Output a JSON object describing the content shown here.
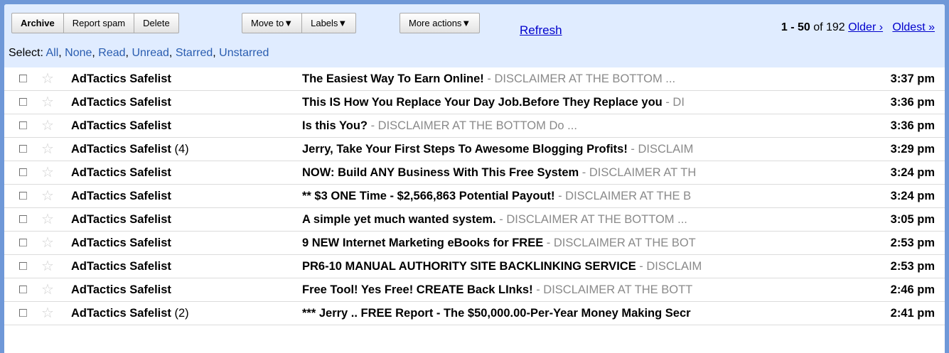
{
  "toolbar": {
    "group1": [
      "Archive",
      "Report spam",
      "Delete"
    ],
    "move_to": "Move to▼",
    "labels": "Labels▼",
    "more_actions": "More actions▼",
    "refresh": "Refresh"
  },
  "pager": {
    "range": "1 - 50",
    "of_text": "of 192",
    "older": "Older ›",
    "oldest": "Oldest »"
  },
  "select": {
    "label": "Select:",
    "options": [
      "All",
      "None",
      "Read",
      "Unread",
      "Starred",
      "Unstarred"
    ]
  },
  "emails": [
    {
      "sender": "AdTactics Safelist",
      "count": "",
      "subject": "The Easiest Way To Earn Online!",
      "snippet": " - DISCLAIMER AT THE BOTTOM ...",
      "time": "3:37 pm"
    },
    {
      "sender": "AdTactics Safelist",
      "count": "",
      "subject": "This IS How You Replace Your Day Job.Before They Replace you",
      "snippet": " - DI",
      "time": "3:36 pm"
    },
    {
      "sender": "AdTactics Safelist",
      "count": "",
      "subject": "Is this You?",
      "snippet": " - DISCLAIMER AT THE BOTTOM Do ...",
      "time": "3:36 pm"
    },
    {
      "sender": "AdTactics Safelist",
      "count": "(4)",
      "subject": "Jerry, Take Your First Steps To Awesome Blogging Profits!",
      "snippet": " - DISCLAIM",
      "time": "3:29 pm"
    },
    {
      "sender": "AdTactics Safelist",
      "count": "",
      "subject": "NOW: Build ANY Business With This Free System",
      "snippet": " - DISCLAIMER AT TH",
      "time": "3:24 pm"
    },
    {
      "sender": "AdTactics Safelist",
      "count": "",
      "subject": "** $3 ONE Time - $2,566,863 Potential Payout!",
      "snippet": " - DISCLAIMER AT THE B",
      "time": "3:24 pm"
    },
    {
      "sender": "AdTactics Safelist",
      "count": "",
      "subject": "A simple yet much wanted system.",
      "snippet": " - DISCLAIMER AT THE BOTTOM ...",
      "time": "3:05 pm"
    },
    {
      "sender": "AdTactics Safelist",
      "count": "",
      "subject": "9 NEW Internet Marketing eBooks for FREE",
      "snippet": " - DISCLAIMER AT THE BOT",
      "time": "2:53 pm"
    },
    {
      "sender": "AdTactics Safelist",
      "count": "",
      "subject": "PR6-10 MANUAL AUTHORITY SITE BACKLINKING SERVICE",
      "snippet": " - DISCLAIM",
      "time": "2:53 pm"
    },
    {
      "sender": "AdTactics Safelist",
      "count": "",
      "subject": "Free Tool! Yes Free! CREATE Back LInks!",
      "snippet": " - DISCLAIMER AT THE BOTT",
      "time": "2:46 pm"
    },
    {
      "sender": "AdTactics Safelist",
      "count": "(2)",
      "subject": "*** Jerry .. FREE Report - The $50,000.00-Per-Year Money Making Secr",
      "snippet": "",
      "time": "2:41 pm"
    }
  ]
}
